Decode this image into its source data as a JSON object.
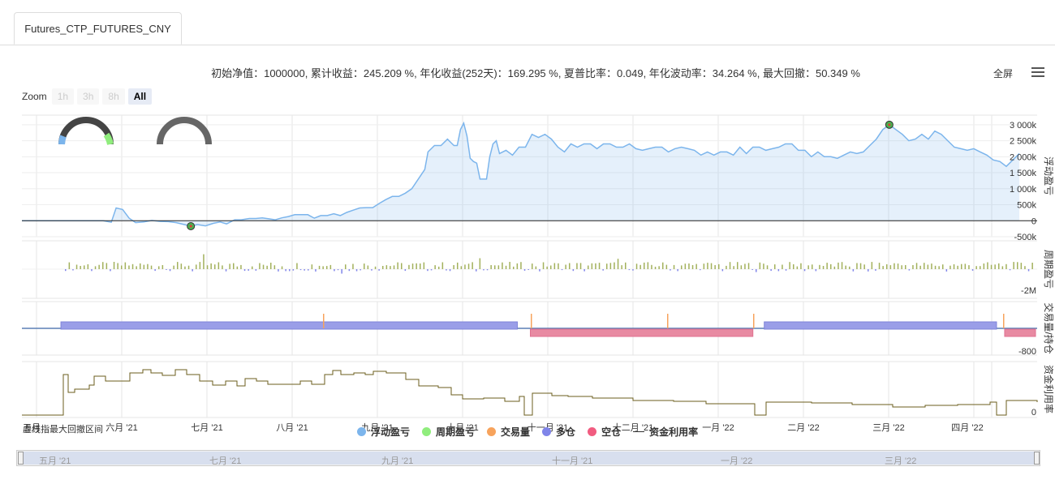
{
  "tab": {
    "label": "Futures_CTP_FUTURES_CNY"
  },
  "summary": "初始净值：1000000, 累计收益：245.209 %, 年化收益(252天)：169.295 %, 夏普比率：0.049, 年化波动率：34.264 %, 最大回撤：50.349 %",
  "toolbar": {
    "fullscreen": "全屏"
  },
  "zoom": {
    "label": "Zoom",
    "buttons": [
      "1h",
      "3h",
      "8h",
      "All"
    ],
    "active": "All"
  },
  "legend": [
    {
      "label": "浮动盈亏",
      "color": "#7cb5ec"
    },
    {
      "label": "周期盈亏",
      "color": "#90ed7d"
    },
    {
      "label": "交易量",
      "color": "#f7a35c"
    },
    {
      "label": "多仓",
      "color": "#8085e9"
    },
    {
      "label": "空仓",
      "color": "#f15c80"
    },
    {
      "label": "资金利用率",
      "color": "#333333"
    }
  ],
  "drawdown_label": "虚线指最大回撤区间",
  "navigator": {
    "labels": [
      "五月 '21",
      "七月 '21",
      "九月 '21",
      "十一月 '21",
      "一月 '22",
      "三月 '22"
    ]
  },
  "chart_data": {
    "type": "line",
    "x_axis_labels": [
      "五月",
      "六月 '21",
      "七月 '21",
      "八月 '21",
      "九月 '21",
      "十月 '21",
      "十一月 '21",
      "十二月 '21",
      "一月 '22",
      "二月 '22",
      "三月 '22",
      "四月 '22"
    ],
    "panels": [
      {
        "name": "浮动盈亏",
        "ylabel": "浮动盈亏",
        "ticks": [
          "3 000k",
          "2 500k",
          "2 000k",
          "1 500k",
          "1 000k",
          "500k",
          "0",
          "-500k"
        ],
        "ylim": [
          -500000,
          3300000
        ],
        "points": [
          [
            0,
            0
          ],
          [
            50,
            0
          ],
          [
            55,
            -50000
          ],
          [
            58,
            400000
          ],
          [
            62,
            350000
          ],
          [
            66,
            80000
          ],
          [
            70,
            -60000
          ],
          [
            75,
            -40000
          ],
          [
            80,
            10000
          ],
          [
            85,
            -20000
          ],
          [
            90,
            -30000
          ],
          [
            95,
            -60000
          ],
          [
            100,
            -120000
          ],
          [
            104,
            -170000
          ],
          [
            108,
            -120000
          ],
          [
            113,
            -160000
          ],
          [
            118,
            -80000
          ],
          [
            122,
            -40000
          ],
          [
            126,
            -100000
          ],
          [
            131,
            30000
          ],
          [
            135,
            30000
          ],
          [
            140,
            70000
          ],
          [
            144,
            70000
          ],
          [
            148,
            90000
          ],
          [
            152,
            60000
          ],
          [
            156,
            30000
          ],
          [
            160,
            90000
          ],
          [
            164,
            130000
          ],
          [
            168,
            190000
          ],
          [
            172,
            190000
          ],
          [
            176,
            190000
          ],
          [
            180,
            80000
          ],
          [
            184,
            160000
          ],
          [
            188,
            160000
          ],
          [
            192,
            220000
          ],
          [
            196,
            160000
          ],
          [
            200,
            260000
          ],
          [
            204,
            330000
          ],
          [
            208,
            400000
          ],
          [
            212,
            410000
          ],
          [
            216,
            410000
          ],
          [
            220,
            540000
          ],
          [
            224,
            660000
          ],
          [
            228,
            760000
          ],
          [
            232,
            760000
          ],
          [
            236,
            860000
          ],
          [
            240,
            1000000
          ],
          [
            244,
            1300000
          ],
          [
            248,
            1600000
          ],
          [
            250,
            2150000
          ],
          [
            254,
            2350000
          ],
          [
            258,
            2350000
          ],
          [
            262,
            2550000
          ],
          [
            264,
            2450000
          ],
          [
            266,
            2350000
          ],
          [
            268,
            2350000
          ],
          [
            270,
            2850000
          ],
          [
            272,
            3050000
          ],
          [
            274,
            2650000
          ],
          [
            276,
            1950000
          ],
          [
            278,
            1850000
          ],
          [
            280,
            1800000
          ],
          [
            282,
            1300000
          ],
          [
            286,
            1300000
          ],
          [
            288,
            2000000
          ],
          [
            290,
            2400000
          ],
          [
            292,
            2500000
          ],
          [
            294,
            2100000
          ],
          [
            298,
            2200000
          ],
          [
            302,
            2050000
          ],
          [
            306,
            2300000
          ],
          [
            310,
            2300000
          ],
          [
            314,
            2700000
          ],
          [
            318,
            2600000
          ],
          [
            322,
            2700000
          ],
          [
            326,
            2550000
          ],
          [
            330,
            2300000
          ],
          [
            334,
            2150000
          ],
          [
            338,
            2400000
          ],
          [
            342,
            2300000
          ],
          [
            346,
            2400000
          ],
          [
            350,
            2400000
          ],
          [
            354,
            2250000
          ],
          [
            358,
            2400000
          ],
          [
            362,
            2400000
          ],
          [
            366,
            2300000
          ],
          [
            370,
            2300000
          ],
          [
            374,
            2400000
          ],
          [
            378,
            2250000
          ],
          [
            382,
            2200000
          ],
          [
            386,
            2250000
          ],
          [
            390,
            2300000
          ],
          [
            394,
            2300000
          ],
          [
            398,
            2150000
          ],
          [
            402,
            2250000
          ],
          [
            406,
            2300000
          ],
          [
            410,
            2250000
          ],
          [
            414,
            2200000
          ],
          [
            418,
            2050000
          ],
          [
            422,
            2150000
          ],
          [
            426,
            2050000
          ],
          [
            430,
            2150000
          ],
          [
            434,
            2150000
          ],
          [
            438,
            2050000
          ],
          [
            442,
            2300000
          ],
          [
            446,
            2100000
          ],
          [
            450,
            2300000
          ],
          [
            454,
            2300000
          ],
          [
            458,
            2200000
          ],
          [
            462,
            2250000
          ],
          [
            466,
            2300000
          ],
          [
            470,
            2400000
          ],
          [
            474,
            2400000
          ],
          [
            478,
            2200000
          ],
          [
            482,
            2200000
          ],
          [
            486,
            2000000
          ],
          [
            490,
            2150000
          ],
          [
            494,
            2000000
          ],
          [
            498,
            2000000
          ],
          [
            502,
            1950000
          ],
          [
            506,
            2050000
          ],
          [
            510,
            2150000
          ],
          [
            514,
            2100000
          ],
          [
            518,
            2150000
          ],
          [
            522,
            2350000
          ],
          [
            526,
            2550000
          ],
          [
            530,
            2850000
          ],
          [
            534,
            3000000
          ],
          [
            538,
            2850000
          ],
          [
            542,
            2700000
          ],
          [
            546,
            2500000
          ],
          [
            550,
            2550000
          ],
          [
            554,
            2700000
          ],
          [
            558,
            2550000
          ],
          [
            562,
            2800000
          ],
          [
            566,
            2700000
          ],
          [
            570,
            2500000
          ],
          [
            574,
            2300000
          ],
          [
            578,
            2250000
          ],
          [
            582,
            2200000
          ],
          [
            586,
            2250000
          ],
          [
            590,
            2150000
          ],
          [
            594,
            2050000
          ],
          [
            598,
            1900000
          ],
          [
            602,
            1850000
          ],
          [
            606,
            1700000
          ],
          [
            610,
            1900000
          ],
          [
            614,
            2100000
          ]
        ],
        "markers": [
          {
            "x": 104,
            "y": -170000,
            "type": "min"
          },
          {
            "x": 534,
            "y": 3000000,
            "type": "max"
          }
        ]
      },
      {
        "name": "周期盈亏",
        "ylabel": "周期盈亏",
        "ticks": [
          "-2M"
        ]
      },
      {
        "name": "交易量/持仓",
        "ylabel": "交易量/持仓",
        "ticks": [
          "-800"
        ],
        "segments": [
          {
            "type": "多仓",
            "from": 24,
            "to": 305
          },
          {
            "type": "空仓",
            "from": 313,
            "to": 450
          },
          {
            "type": "多仓",
            "from": 457,
            "to": 600
          },
          {
            "type": "空仓",
            "from": 605,
            "to": 624
          }
        ]
      },
      {
        "name": "资金利用率",
        "ylabel": "资金利用率",
        "ticks": [
          "0"
        ]
      }
    ]
  }
}
